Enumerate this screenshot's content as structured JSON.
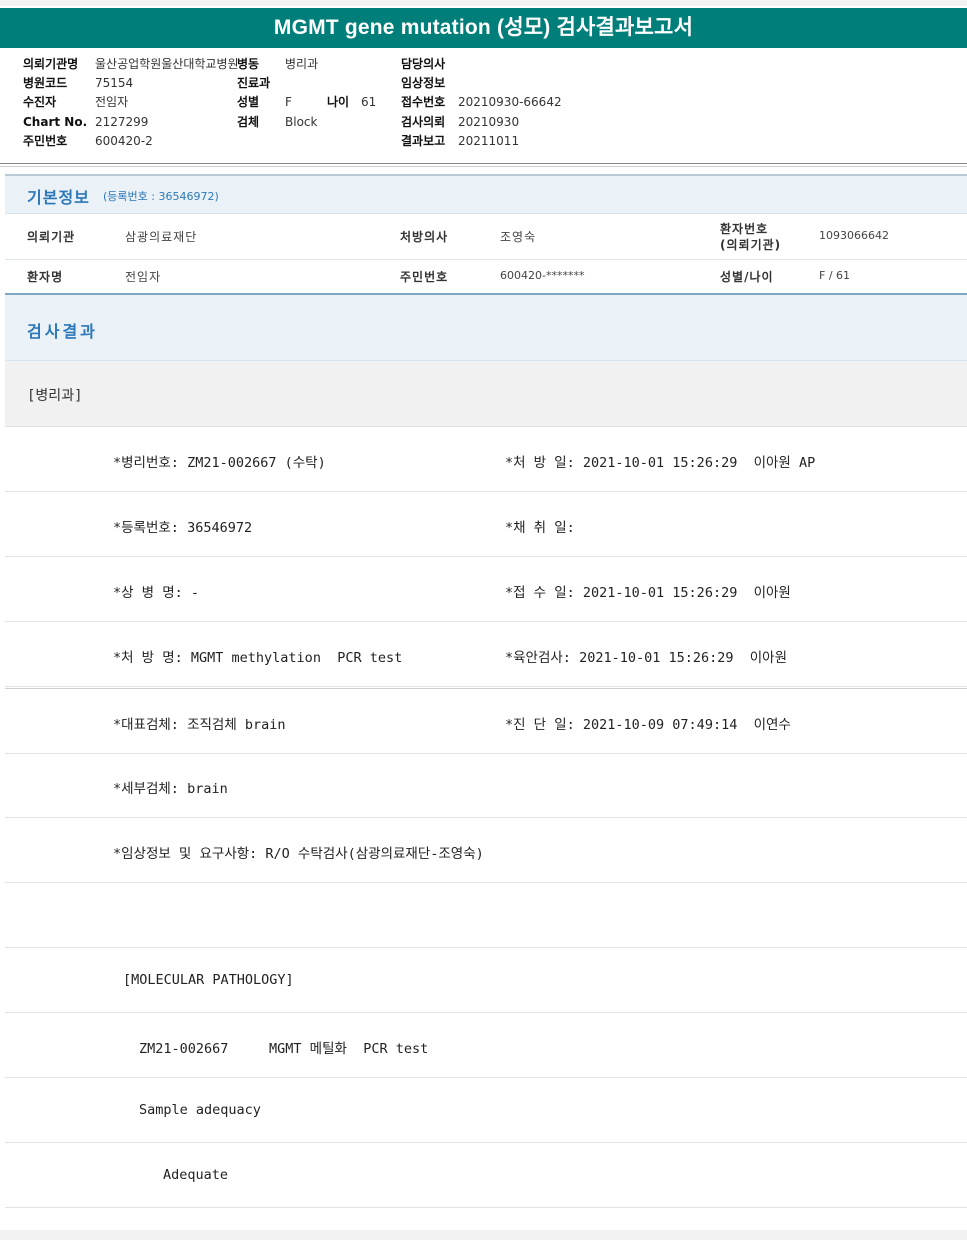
{
  "report": {
    "title": "MGMT gene mutation (성모) 검사결과보고서"
  },
  "header": {
    "inst_label": "의뢰기관명",
    "inst_value": "울산공업학원울산대학교병원",
    "ward_label": "병동",
    "ward_value": "병리과",
    "doctor_label": "담당의사",
    "doctor_value": "",
    "code_label": "병원코드",
    "code_value": "75154",
    "dept_label": "진료과",
    "dept_value": "",
    "clinical_label": "임상정보",
    "clinical_value": "",
    "patient_label": "수진자",
    "patient_value": "전임자",
    "sex_label": "성별",
    "sex_value": "F",
    "age_label": "나이",
    "age_value": "61",
    "recv_label": "접수번호",
    "recv_value": "20210930-66642",
    "chart_label": "Chart No.",
    "chart_value": "2127299",
    "specimen_label": "검체",
    "specimen_value": "Block",
    "req_label": "검사의뢰",
    "req_value": "20210930",
    "rrn_label": "주민번호",
    "rrn_value": "600420-2",
    "report_label": "결과보고",
    "report_value": "20211011"
  },
  "basic": {
    "title": "기본정보",
    "sub": "(등록번호 : 36546972)",
    "rows": [
      {
        "l1": "의뢰기관",
        "v1": "삼광의료재단",
        "l2": "처방의사",
        "v2": "조영숙",
        "l3a": "환자번호",
        "l3b": "(의뢰기관)",
        "v3": "1093066642"
      },
      {
        "l1": "환자명",
        "v1": "전임자",
        "l2": "주민번호",
        "v2": "600420-*******",
        "l3": "성별/나이",
        "v3": "F / 61"
      }
    ]
  },
  "result": {
    "title": "검사결과",
    "dept": "[병리과]",
    "rows": [
      {
        "left": "*병리번호: ZM21-002667 (수탁)",
        "right": "*처 방 일: 2021-10-01 15:26:29  이아원 AP"
      },
      {
        "left": "*등록번호: 36546972",
        "right": "*채 취 일:"
      },
      {
        "left": "*상 병 명: -",
        "right": "*접 수 일: 2021-10-01 15:26:29  이아원"
      },
      {
        "left": "*처 방 명: MGMT methylation  PCR test",
        "right": "*육안검사: 2021-10-01 15:26:29  이아원"
      },
      {
        "left": "*대표검체: 조직검체 brain",
        "right": "*진 단 일: 2021-10-09 07:49:14  이연수"
      },
      {
        "left": "*세부검체: brain",
        "right": ""
      },
      {
        "left": "*임상정보 및 요구사항: R/O 수탁검사(삼광의료재단-조영숙)",
        "right": ""
      }
    ],
    "molecular": {
      "heading": "[MOLECULAR PATHOLOGY]",
      "test_line": "ZM21-002667     MGMT 메틸화  PCR test",
      "adequacy_label": "Sample adequacy",
      "adequacy_value": "Adequate"
    }
  }
}
